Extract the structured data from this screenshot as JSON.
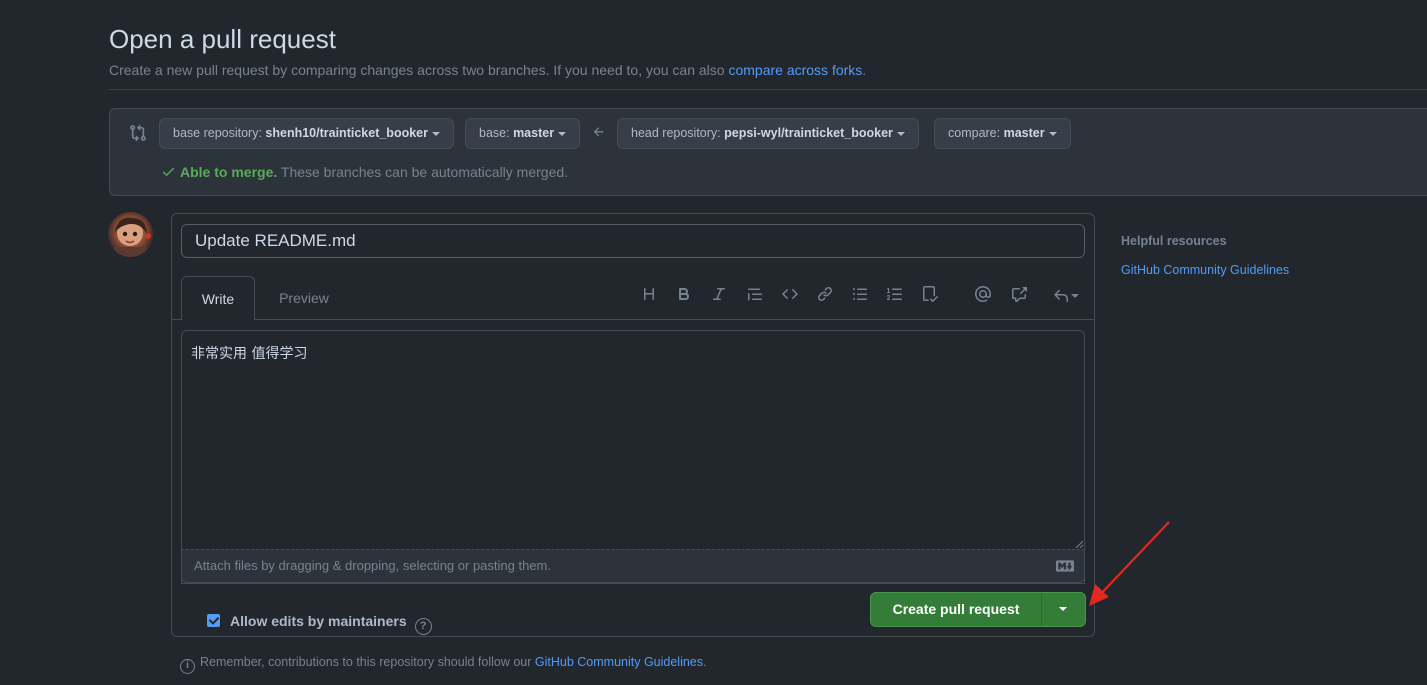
{
  "header": {
    "title": "Open a pull request",
    "subtitle_text": "Create a new pull request by comparing changes across two branches. If you need to, you can also ",
    "subtitle_link": "compare across forks",
    "subtitle_end": "."
  },
  "compare": {
    "base_repo_label": "base repository: ",
    "base_repo_value": "shenh10/trainticket_booker",
    "base_label": "base: ",
    "base_value": "master",
    "head_repo_label": "head repository: ",
    "head_repo_value": "pepsi-wyl/trainticket_booker",
    "compare_label": "compare: ",
    "compare_value": "master",
    "merge_ok": "Able to merge.",
    "merge_text": " These branches can be automatically merged."
  },
  "editor": {
    "title_value": "Update README.md",
    "tabs": [
      {
        "label": "Write"
      },
      {
        "label": "Preview"
      }
    ],
    "body_value": "非常实用 值得学习",
    "attach_text": "Attach files by dragging & dropping, selecting or pasting them.",
    "allow_edits_label": "Allow edits by maintainers",
    "allow_edits_checked": true,
    "create_button_label": "Create pull request",
    "toolbar_icons": [
      "heading-icon",
      "bold-icon",
      "italic-icon",
      "quote-icon",
      "code-icon",
      "link-icon",
      "unordered-list-icon",
      "ordered-list-icon",
      "task-list-icon",
      "mention-icon",
      "cross-reference-icon",
      "reply-icon"
    ]
  },
  "footer": {
    "remember_text": "Remember, contributions to this repository should follow our ",
    "remember_link": "GitHub Community Guidelines",
    "remember_end": "."
  },
  "sidebar": {
    "heading": "Helpful resources",
    "link": "GitHub Community Guidelines"
  },
  "colors": {
    "background": "#22272e",
    "accent_link": "#539bf5",
    "success": "#57ab5a",
    "primary_button": "#347d39",
    "annotation_arrow": "#e5271f"
  }
}
